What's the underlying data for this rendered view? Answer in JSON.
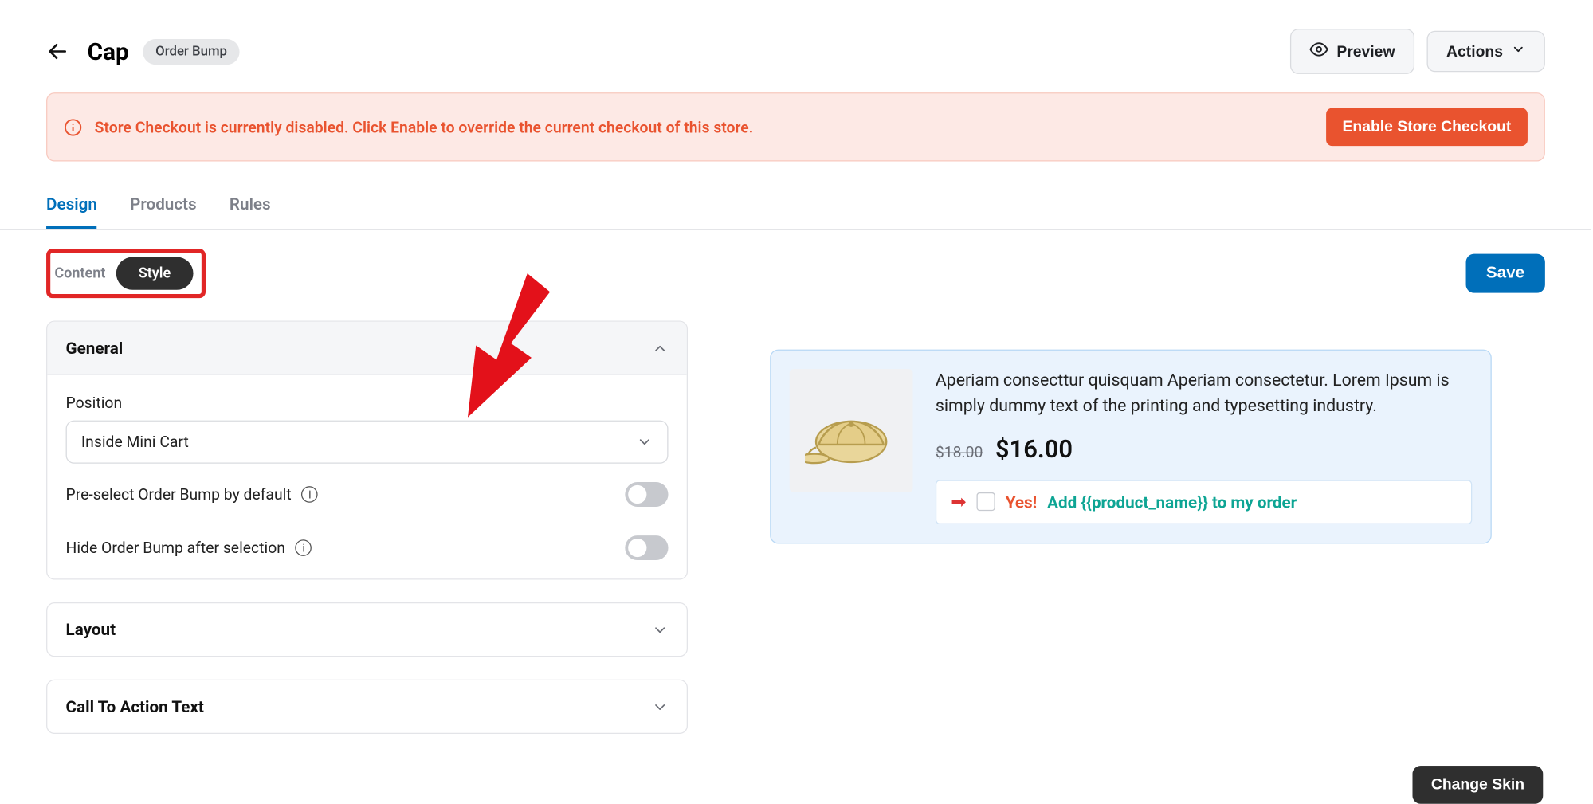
{
  "header": {
    "title": "Cap",
    "badge": "Order Bump",
    "preview": "Preview",
    "actions": "Actions"
  },
  "alert": {
    "text": "Store Checkout is currently disabled. Click Enable to override the current checkout of this store.",
    "button": "Enable Store Checkout"
  },
  "tabs": {
    "design": "Design",
    "products": "Products",
    "rules": "Rules"
  },
  "segments": {
    "content": "Content",
    "style": "Style"
  },
  "save_label": "Save",
  "panels": {
    "general": {
      "title": "General",
      "position_label": "Position",
      "position_value": "Inside Mini Cart",
      "preselect_label": "Pre-select Order Bump by default",
      "hide_after_label": "Hide Order Bump after selection"
    },
    "layout_title": "Layout",
    "cta_title": "Call To Action Text"
  },
  "preview": {
    "desc": "Aperiam consecttur quisquam Aperiam consectetur. Lorem Ipsum is simply dummy text of the printing and typesetting industry.",
    "price_strike": "$18.00",
    "price_sale": "$16.00",
    "cta_yes": "Yes!",
    "cta_rest": "Add {{product_name}} to my order",
    "change_skin": "Change Skin"
  }
}
